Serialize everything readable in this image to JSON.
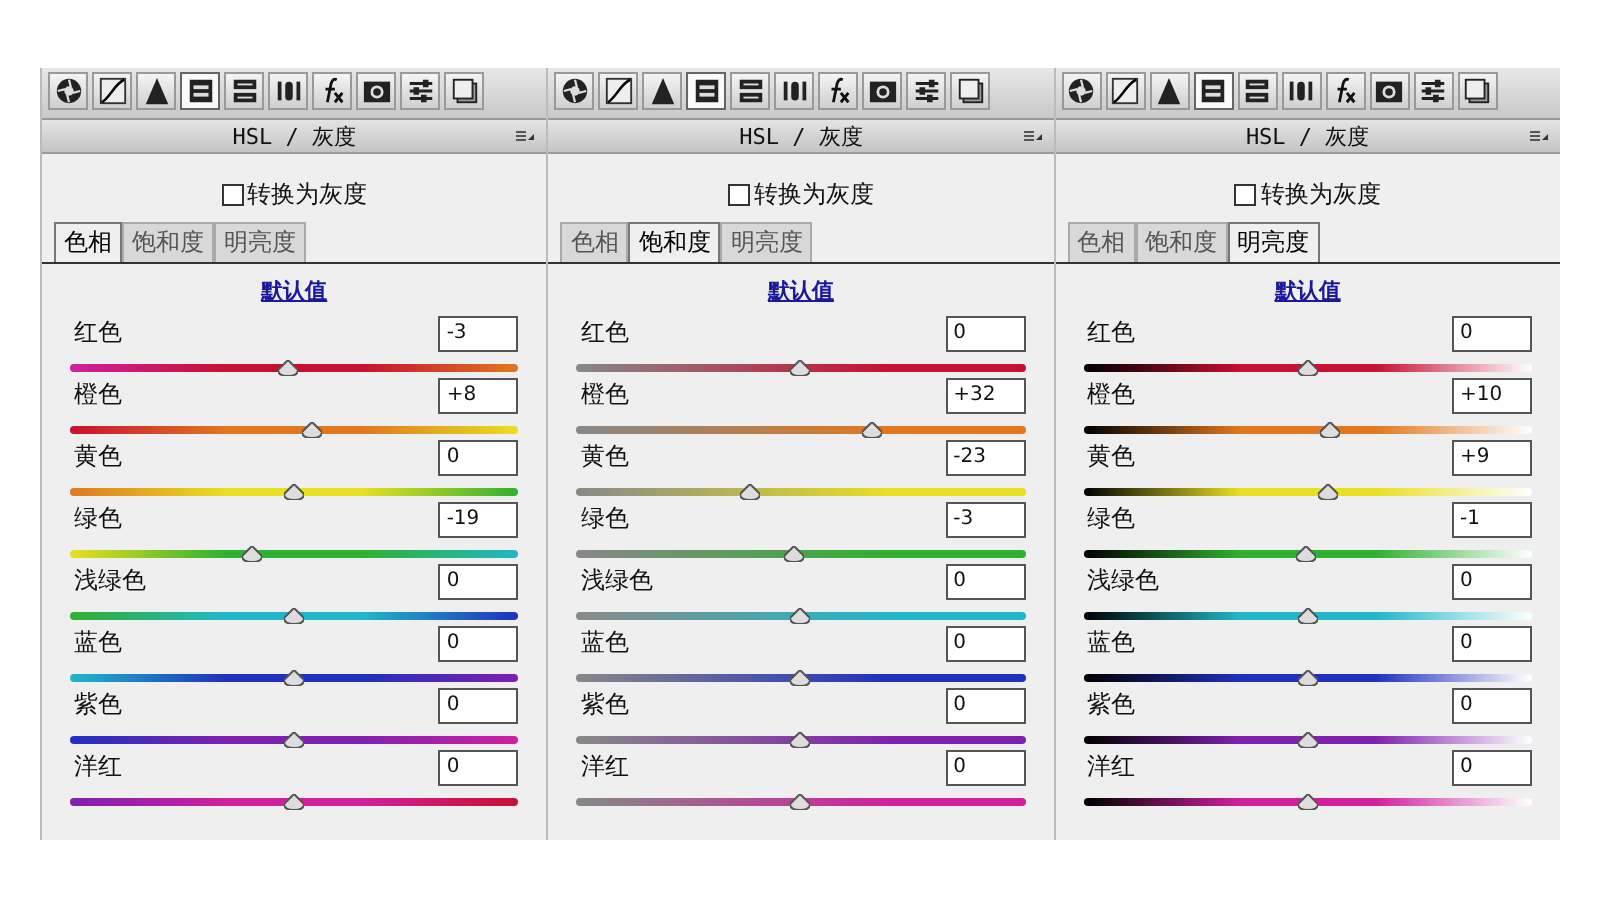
{
  "panels": [
    {
      "tools": [
        {
          "kind": "aperture",
          "selected": false
        },
        {
          "kind": "curve",
          "selected": false
        },
        {
          "kind": "triangle",
          "selected": false
        },
        {
          "kind": "hsl",
          "selected": true
        },
        {
          "kind": "split",
          "selected": false
        },
        {
          "kind": "lens",
          "selected": false
        },
        {
          "kind": "fx",
          "selected": false
        },
        {
          "kind": "camera",
          "selected": false
        },
        {
          "kind": "sliders",
          "selected": false
        },
        {
          "kind": "presets",
          "selected": false
        }
      ],
      "title": "HSL / 灰度",
      "checkbox": {
        "label": "转换为灰度",
        "checked": false
      },
      "tabs": [
        {
          "label": "色相",
          "selected": true
        },
        {
          "label": "饱和度",
          "selected": false
        },
        {
          "label": "明亮度",
          "selected": false
        }
      ],
      "link": "默认值",
      "sliders": [
        {
          "name": "红色",
          "value": "-3",
          "level": 0.485,
          "color": "#c81030"
        },
        {
          "name": "橙色",
          "value": "+8",
          "level": 0.54,
          "color": "#e07820"
        },
        {
          "name": "黄色",
          "value": "0",
          "level": 0.5,
          "color": "#e8e020"
        },
        {
          "name": "绿色",
          "value": "-19",
          "level": 0.405,
          "color": "#30b030"
        },
        {
          "name": "浅绿色",
          "value": "0",
          "level": 0.5,
          "color": "#20b8c8"
        },
        {
          "name": "蓝色",
          "value": "0",
          "level": 0.5,
          "color": "#2030c0"
        },
        {
          "name": "紫色",
          "value": "0",
          "level": 0.5,
          "color": "#8020b0"
        },
        {
          "name": "洋红",
          "value": "0",
          "level": 0.5,
          "color": "#d020a0"
        }
      ]
    },
    {
      "tools": [
        {
          "kind": "aperture",
          "selected": false
        },
        {
          "kind": "curve",
          "selected": false
        },
        {
          "kind": "triangle",
          "selected": false
        },
        {
          "kind": "hsl",
          "selected": true
        },
        {
          "kind": "split",
          "selected": false
        },
        {
          "kind": "lens",
          "selected": false
        },
        {
          "kind": "fx",
          "selected": false
        },
        {
          "kind": "camera",
          "selected": false
        },
        {
          "kind": "sliders",
          "selected": false
        },
        {
          "kind": "presets",
          "selected": false
        }
      ],
      "title": "HSL / 灰度",
      "checkbox": {
        "label": "转换为灰度",
        "checked": false
      },
      "tabs": [
        {
          "label": "色相",
          "selected": false
        },
        {
          "label": "饱和度",
          "selected": true
        },
        {
          "label": "明亮度",
          "selected": false
        }
      ],
      "link": "默认值",
      "sliders": [
        {
          "name": "红色",
          "value": "0",
          "level": 0.5,
          "color": "#c81030"
        },
        {
          "name": "橙色",
          "value": "+32",
          "level": 0.66,
          "color": "#e07820"
        },
        {
          "name": "黄色",
          "value": "-23",
          "level": 0.385,
          "color": "#e8e020"
        },
        {
          "name": "绿色",
          "value": "-3",
          "level": 0.485,
          "color": "#30b030"
        },
        {
          "name": "浅绿色",
          "value": "0",
          "level": 0.5,
          "color": "#20b8c8"
        },
        {
          "name": "蓝色",
          "value": "0",
          "level": 0.5,
          "color": "#2030c0"
        },
        {
          "name": "紫色",
          "value": "0",
          "level": 0.5,
          "color": "#8020b0"
        },
        {
          "name": "洋红",
          "value": "0",
          "level": 0.5,
          "color": "#d020a0"
        }
      ]
    },
    {
      "tools": [
        {
          "kind": "aperture",
          "selected": false
        },
        {
          "kind": "curve",
          "selected": false
        },
        {
          "kind": "triangle",
          "selected": false
        },
        {
          "kind": "hsl",
          "selected": true
        },
        {
          "kind": "split",
          "selected": false
        },
        {
          "kind": "lens",
          "selected": false
        },
        {
          "kind": "fx",
          "selected": false
        },
        {
          "kind": "camera",
          "selected": false
        },
        {
          "kind": "sliders",
          "selected": false
        },
        {
          "kind": "presets",
          "selected": false
        }
      ],
      "title": "HSL / 灰度",
      "checkbox": {
        "label": "转换为灰度",
        "checked": false
      },
      "tabs": [
        {
          "label": "色相",
          "selected": false
        },
        {
          "label": "饱和度",
          "selected": false
        },
        {
          "label": "明亮度",
          "selected": true
        }
      ],
      "link": "默认值",
      "sliders": [
        {
          "name": "红色",
          "value": "0",
          "level": 0.5,
          "color": "#c81030"
        },
        {
          "name": "橙色",
          "value": "+10",
          "level": 0.55,
          "color": "#e07820"
        },
        {
          "name": "黄色",
          "value": "+9",
          "level": 0.545,
          "color": "#e8e020"
        },
        {
          "name": "绿色",
          "value": "-1",
          "level": 0.495,
          "color": "#30b030"
        },
        {
          "name": "浅绿色",
          "value": "0",
          "level": 0.5,
          "color": "#20b8c8"
        },
        {
          "name": "蓝色",
          "value": "0",
          "level": 0.5,
          "color": "#2030c0"
        },
        {
          "name": "紫色",
          "value": "0",
          "level": 0.5,
          "color": "#8020b0"
        },
        {
          "name": "洋红",
          "value": "0",
          "level": 0.5,
          "color": "#d020a0"
        }
      ]
    }
  ]
}
